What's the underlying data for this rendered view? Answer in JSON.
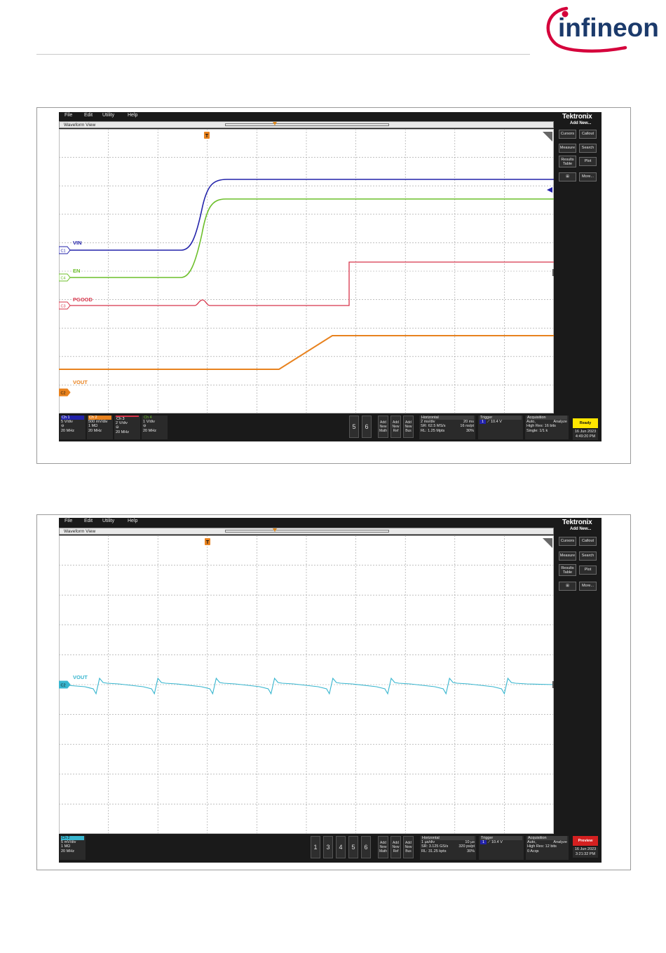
{
  "brand": {
    "logo_text": "infineon",
    "logo_color": "#d5003b",
    "logo_dark": "#1b3a6b"
  },
  "menu": [
    "File",
    "Edit",
    "Utility",
    "Help"
  ],
  "scope1": {
    "window_title": "Waveform View",
    "vendor": "Tektronix",
    "add_new": "Add New...",
    "side_buttons": {
      "cursors": "Cursors",
      "callout": "Callout",
      "measure": "Measure",
      "search": "Search",
      "results_l1": "Results",
      "results_l2": "Table",
      "plot": "Plot",
      "more": "More..."
    },
    "traces": [
      {
        "name": "VIN",
        "marker": "C1",
        "color": "#2222aa"
      },
      {
        "name": "EN",
        "marker": "C4",
        "color": "#6cbf2a"
      },
      {
        "name": "PGOOD",
        "marker": "C3",
        "color": "#d8344a"
      },
      {
        "name": "VOUT",
        "marker": "C2",
        "color": "#e8821e"
      }
    ],
    "channels": [
      {
        "head": "Ch 1",
        "scale": "5 V/div",
        "imp": "",
        "bw": "20 MHz",
        "color": "#2222aa"
      },
      {
        "head": "Ch 2",
        "scale": "500 mV/div",
        "imp": "1 MΩ",
        "bw": "20 MHz",
        "color": "#e8821e"
      },
      {
        "head": "Ch 3",
        "scale": "2 V/div",
        "imp": "",
        "bw": "20 MHz",
        "color": "#d8344a"
      },
      {
        "head": "Ch 4",
        "scale": "1 V/div",
        "imp": "",
        "bw": "20 MHz",
        "color": "#6cbf2a"
      }
    ],
    "num_buttons": [
      "5",
      "6"
    ],
    "add_buttons": [
      {
        "l1": "Add",
        "l2": "New",
        "l3": "Math"
      },
      {
        "l1": "Add",
        "l2": "New",
        "l3": "Ref"
      },
      {
        "l1": "Add",
        "l2": "New",
        "l3": "Bus"
      }
    ],
    "horizontal": {
      "title": "Horizontal",
      "scale": "2 ms/div",
      "length": "20 ms",
      "sr": "SR: 62.5 MS/s",
      "pt": "16 ns/pt",
      "rl": "RL: 1.25 Mpts",
      "pos": "30%"
    },
    "trigger": {
      "title": "Trigger",
      "source": "1",
      "level": "10.4 V"
    },
    "acquisition": {
      "title": "Acquisition",
      "mode": "Auto,",
      "analyze": "Analyze",
      "res": "High Res: 16 bits",
      "extra": "Single: 1/1 k"
    },
    "status": {
      "label": "Ready",
      "bg": "#ffe600",
      "fg": "#111111"
    },
    "date": "16 Jun 2023",
    "time": "4:49:20 PM"
  },
  "scope2": {
    "window_title": "Waveform View",
    "vendor": "Tektronix",
    "add_new": "Add New...",
    "side_buttons": {
      "cursors": "Cursors",
      "callout": "Callout",
      "measure": "Measure",
      "search": "Search",
      "results_l1": "Results",
      "results_l2": "Table",
      "plot": "Plot",
      "more": "More..."
    },
    "traces": [
      {
        "name": "VOUT",
        "marker": "C2",
        "color": "#38b6cf"
      }
    ],
    "channels": [
      {
        "head": "Ch 2",
        "scale": "5 mV/div",
        "imp": "1 MΩ",
        "bw": "20 MHz",
        "color": "#38b6cf"
      }
    ],
    "num_buttons": [
      "1",
      "3",
      "4",
      "5",
      "6"
    ],
    "add_buttons": [
      {
        "l1": "Add",
        "l2": "New",
        "l3": "Math"
      },
      {
        "l1": "Add",
        "l2": "New",
        "l3": "Ref"
      },
      {
        "l1": "Add",
        "l2": "New",
        "l3": "Bus"
      }
    ],
    "horizontal": {
      "title": "Horizontal",
      "scale": "1 µs/div",
      "length": "10 µs",
      "sr": "SR: 3.125 GS/s",
      "pt": "320 ps/pt",
      "rl": "RL: 31.25 kpts",
      "pos": "30%"
    },
    "trigger": {
      "title": "Trigger",
      "source": "1",
      "level": "10.4 V"
    },
    "acquisition": {
      "title": "Acquisition",
      "mode": "Auto,",
      "analyze": "Analyze",
      "res": "High Res: 12 bits",
      "extra": "0 Acqs"
    },
    "status": {
      "label": "Preview",
      "bg": "#d42020",
      "fg": "#ffffff"
    },
    "date": "16 Jun 2023",
    "time": "3:21:32 PM"
  }
}
